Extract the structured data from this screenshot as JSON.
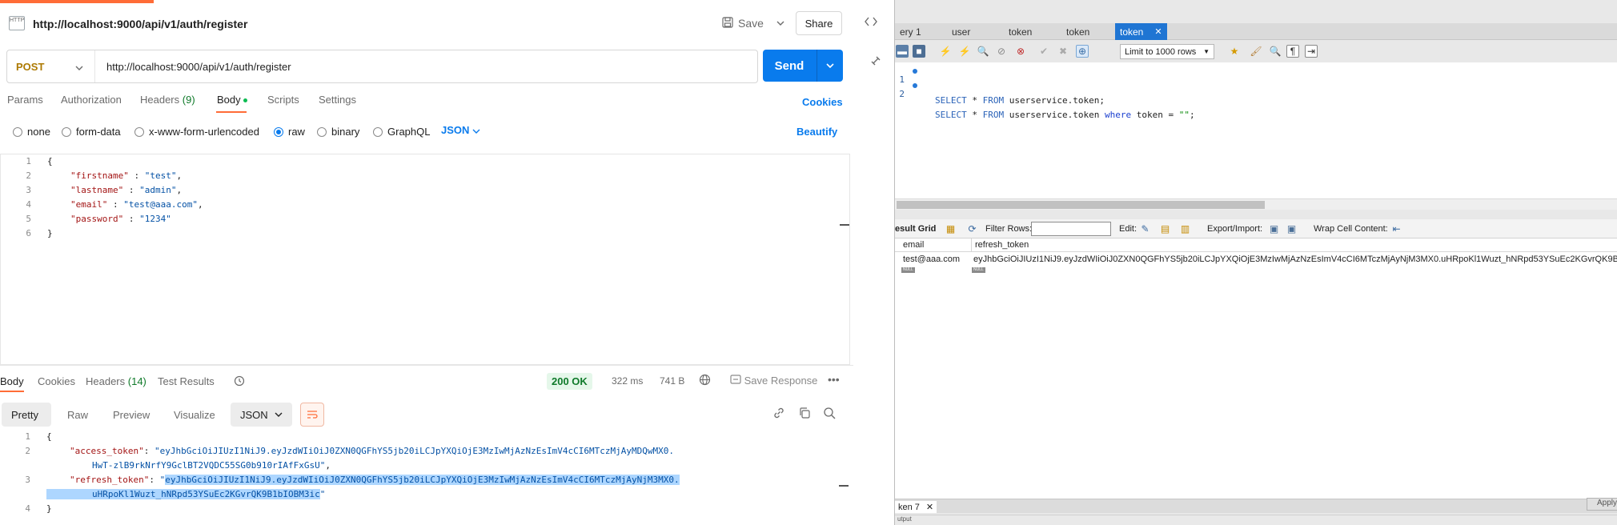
{
  "postman": {
    "request_title": "http://localhost:9000/api/v1/auth/register",
    "http_badge": "HTTP",
    "save_label": "Save",
    "share_label": "Share",
    "method": "POST",
    "url": "http://localhost:9000/api/v1/auth/register",
    "send_label": "Send",
    "request_tabs": {
      "params": "Params",
      "authorization": "Authorization",
      "headers": "Headers",
      "headers_count": "(9)",
      "body": "Body",
      "scripts": "Scripts",
      "settings": "Settings"
    },
    "cookies_label": "Cookies",
    "body_types": {
      "none": "none",
      "form_data": "form-data",
      "urlencoded": "x-www-form-urlencoded",
      "raw": "raw",
      "binary": "binary",
      "graphql": "GraphQL",
      "selected": "raw"
    },
    "format_select": "JSON",
    "beautify_label": "Beautify",
    "request_body": {
      "line_numbers": [
        "1",
        "2",
        "3",
        "4",
        "5",
        "6"
      ],
      "open_brace": "{",
      "close_brace": "}",
      "fields": [
        {
          "key": "\"firstname\"",
          "sep": " : ",
          "value": "\"test\"",
          "trail": ","
        },
        {
          "key": "\"lastname\"",
          "sep": " : ",
          "value": "\"admin\"",
          "trail": ","
        },
        {
          "key": "\"email\"",
          "sep": " : ",
          "value": "\"test@aaa.com\"",
          "trail": ","
        },
        {
          "key": "\"password\"",
          "sep": " : ",
          "value": "\"1234\"",
          "trail": ""
        }
      ]
    },
    "response_tabs": {
      "body": "Body",
      "cookies": "Cookies",
      "headers": "Headers",
      "headers_count": "(14)",
      "test_results": "Test Results"
    },
    "status": "200 OK",
    "time": "322 ms",
    "size": "741 B",
    "save_response_label": "Save Response",
    "view_modes": {
      "pretty": "Pretty",
      "raw": "Raw",
      "preview": "Preview",
      "visualize": "Visualize",
      "selected": "Pretty"
    },
    "response_format": "JSON",
    "response_body": {
      "line_numbers": [
        "1",
        "2",
        "",
        "3",
        "",
        "4"
      ],
      "open_brace": "{",
      "close_brace": "}",
      "access_key": "\"access_token\"",
      "access_value_part1": "\"eyJhbGciOiJIUzI1NiJ9.eyJzdWIiOiJ0ZXN0QGFhYS5jb20iLCJpYXQiOjE3MzIwMjAzNzEsImV4cCI6MTczMjAyMDQwMX0.",
      "access_value_part2": "HwT-zlB9rkNrfY9GclBT2VQDC55SG0b910rIAfFxGsU\"",
      "refresh_key": "\"refresh_token\"",
      "refresh_value_part1": "eyJhbGciOiJIUzI1NiJ9.eyJzdWIiOiJ0ZXN0QGFhYS5jb20iLCJpYXQiOjE3MzIwMjAzNzEsImV4cCI6MTczMjAyNjM3MX0.",
      "refresh_value_part2": "uHRpoKl1Wuzt_hNRpd53YSuEc2KGvrQK9B1bIOBM3ic"
    }
  },
  "workbench": {
    "tabs": [
      {
        "label": "ery 1",
        "active": false
      },
      {
        "label": "user",
        "active": false
      },
      {
        "label": "token",
        "active": false
      },
      {
        "label": "token",
        "active": false
      },
      {
        "label": "token",
        "active": true
      }
    ],
    "limit_select": "Limit to 1000 rows",
    "sql_lines": [
      {
        "num": "1",
        "kw1": "SELECT",
        "star": " * ",
        "kw2": "FROM",
        "rest": " userservice.token;"
      },
      {
        "num": "2",
        "kw1": "SELECT",
        "star": " * ",
        "kw2": "FROM",
        "rest": " userservice.token ",
        "kw3": "where",
        "rest2": " token = ",
        "str": "\"\"",
        "end": ";"
      }
    ],
    "result_toolbar": {
      "result_grid": "esult Grid",
      "filter_rows": "Filter Rows:",
      "edit": "Edit:",
      "export_import": "Export/Import:",
      "wrap_cell": "Wrap Cell Content:"
    },
    "grid": {
      "columns": [
        "email",
        "refresh_token"
      ],
      "rows": [
        [
          "test@aaa.com",
          "eyJhbGciOiJIUzI1NiJ9.eyJzdWIiOiJ0ZXN0QGFhYS5jb20iLCJpYXQiOjE3MzIwMjAzNzEsImV4cCI6MTczMjAyNjM3MX0.uHRpoKl1Wuzt_hNRpd53YSuEc2KGvrQK9B1bIOB..."
        ]
      ],
      "null_label": "NULL"
    },
    "bottom_tab": "ken 7",
    "apply_label": "Apply",
    "output_label": "utput"
  },
  "colors": {
    "postman_accent": "#ff6c37",
    "send_blue": "#097bed",
    "status_green": "#0f7a2a",
    "workbench_tab_active": "#1f75d3",
    "selection": "#add6ff"
  }
}
